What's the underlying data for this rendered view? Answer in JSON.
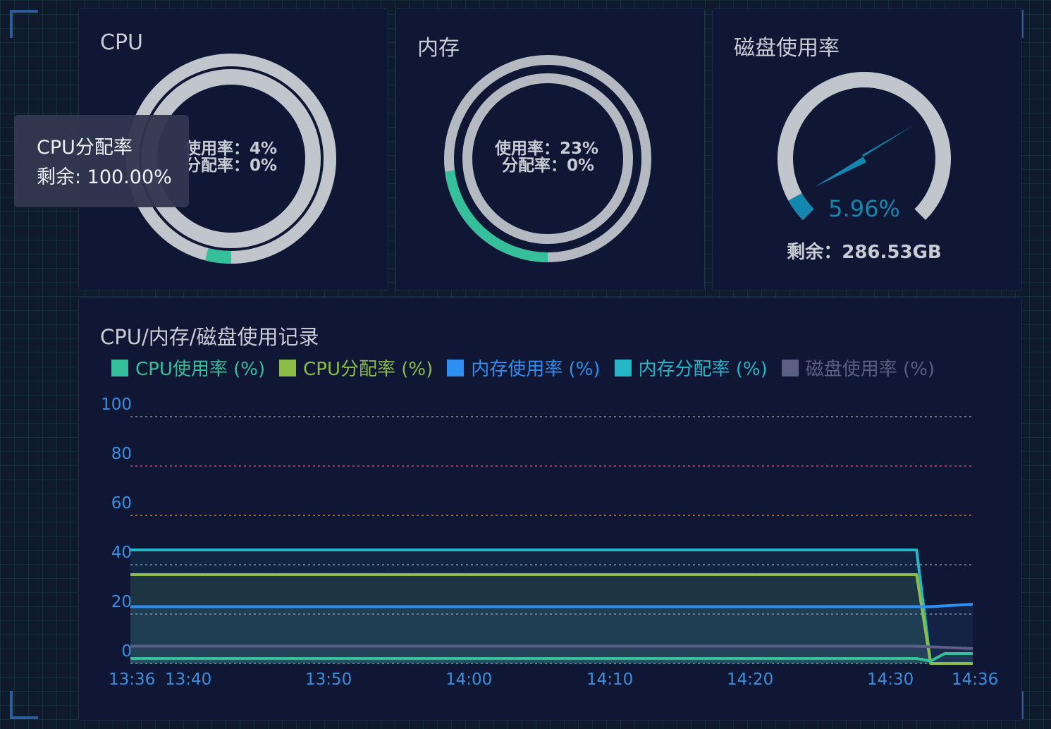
{
  "panels": {
    "cpu": {
      "title": "CPU",
      "usage_label": "使用率：4%",
      "alloc_label": "分配率：0%",
      "usage_pct": 4,
      "alloc_pct": 0
    },
    "memory": {
      "title": "内存",
      "usage_label": "使用率：23%",
      "alloc_label": "分配率：0%",
      "usage_pct": 23,
      "alloc_pct": 0
    },
    "disk": {
      "title": "磁盘使用率",
      "percent_label": "5.96%",
      "percent": 5.96,
      "remaining_label": "剩余：286.53GB"
    }
  },
  "tooltip": {
    "title": "CPU分配率",
    "value": "剩余: 100.00%"
  },
  "chart_title": "CPU/内存/磁盘使用记录",
  "colors": {
    "cpu_usage": "#35bf9a",
    "cpu_alloc": "#8bbd48",
    "mem_usage": "#2f8ff0",
    "mem_alloc": "#27b5c8",
    "disk_usage": "#5d5e85",
    "gauge_track": "#c1c5cc",
    "disk_accent": "#1387ad"
  },
  "chart_data": {
    "type": "line",
    "title": "CPU/内存/磁盘使用记录",
    "legend_position": "top-left",
    "x_ticks": [
      "13:36",
      "13:40",
      "13:50",
      "14:00",
      "14:10",
      "14:20",
      "14:30",
      "14:36"
    ],
    "x_range": [
      "13:36",
      "14:36"
    ],
    "y_ticks": [
      "100",
      "80",
      "60",
      "40",
      "20",
      "0"
    ],
    "ylim": [
      0,
      100
    ],
    "threshold_lines": [
      100,
      80,
      60,
      40,
      20,
      0
    ],
    "series": [
      {
        "name": "CPU使用率 (%)",
        "points": [
          [
            "13:36",
            2
          ],
          [
            "14:32",
            2
          ],
          [
            "14:33",
            1
          ],
          [
            "14:34",
            4
          ],
          [
            "14:36",
            4
          ]
        ]
      },
      {
        "name": "CPU分配率 (%)",
        "points": [
          [
            "13:36",
            36
          ],
          [
            "14:32",
            36
          ],
          [
            "14:33",
            0
          ],
          [
            "14:34",
            0
          ],
          [
            "14:36",
            0
          ]
        ]
      },
      {
        "name": "内存使用率 (%)",
        "points": [
          [
            "13:36",
            23
          ],
          [
            "14:32",
            23
          ],
          [
            "14:33",
            23
          ],
          [
            "14:36",
            24
          ]
        ]
      },
      {
        "name": "内存分配率 (%)",
        "points": [
          [
            "13:36",
            46
          ],
          [
            "14:32",
            46
          ],
          [
            "14:33",
            0
          ],
          [
            "14:34",
            0
          ],
          [
            "14:36",
            0
          ]
        ]
      },
      {
        "name": "磁盘使用率 (%)",
        "points": [
          [
            "13:36",
            7
          ],
          [
            "14:32",
            7
          ],
          [
            "14:36",
            6
          ]
        ]
      }
    ]
  }
}
